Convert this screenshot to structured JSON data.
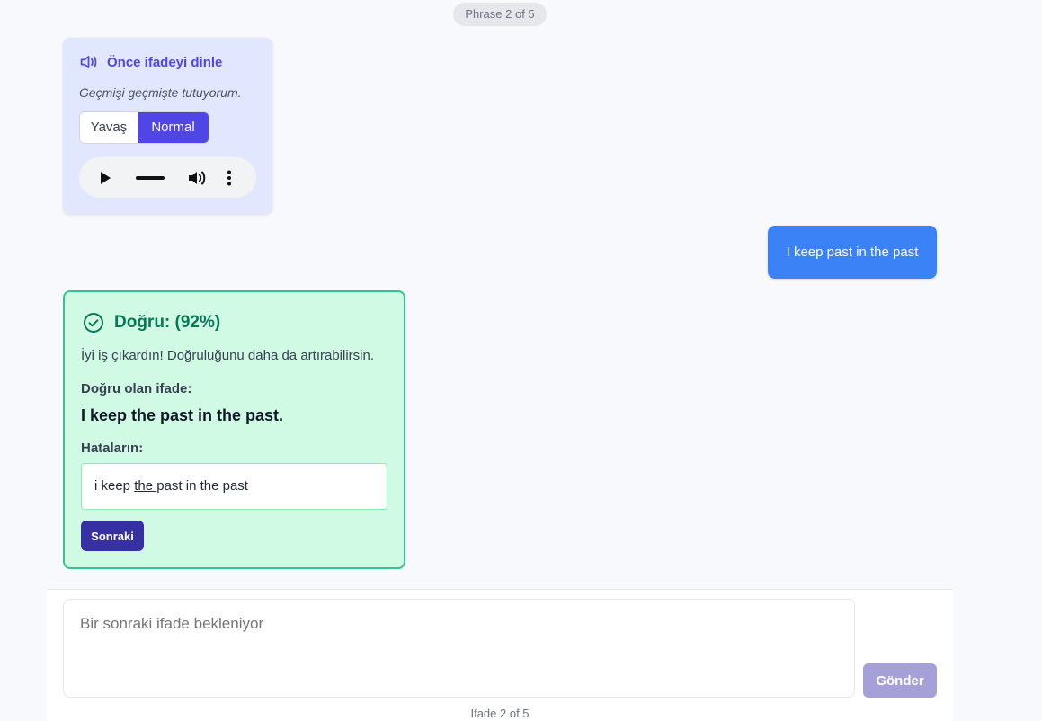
{
  "progress_pill": "Phrase 2 of 5",
  "listen": {
    "title": "Önce ifadeyi dinle",
    "phrase": "Geçmişi geçmişte tutuyorum.",
    "speed_slow": "Yavaş",
    "speed_normal": "Normal",
    "selected_speed": "Normal"
  },
  "user_message": "I keep past in the past",
  "feedback": {
    "title": "Doğru: (92%)",
    "message": "İyi iş çıkardın! Doğruluğunu daha da artırabilirsin.",
    "correct_label": "Doğru olan ifade:",
    "correct_phrase": "I keep the past in the past.",
    "mistakes_label": "Hataların:",
    "mistake_before": "i keep ",
    "mistake_missing": "the ",
    "mistake_after": "past in the past",
    "next_button": "Sonraki"
  },
  "composer": {
    "placeholder": "Bir sonraki ifade bekleniyor",
    "send_button": "Gönder",
    "footer_count": "İfade 2 of 5"
  },
  "colors": {
    "accent": "#4f46e5",
    "user_bubble": "#3b82f6",
    "success_bg": "#d1fae5",
    "success_border": "#34c38f",
    "success_text": "#047857"
  },
  "icons": {
    "listen": "speaker-icon",
    "feedback": "check-circle-icon",
    "play": "play-icon",
    "volume": "volume-icon",
    "more": "more-vertical-icon"
  }
}
